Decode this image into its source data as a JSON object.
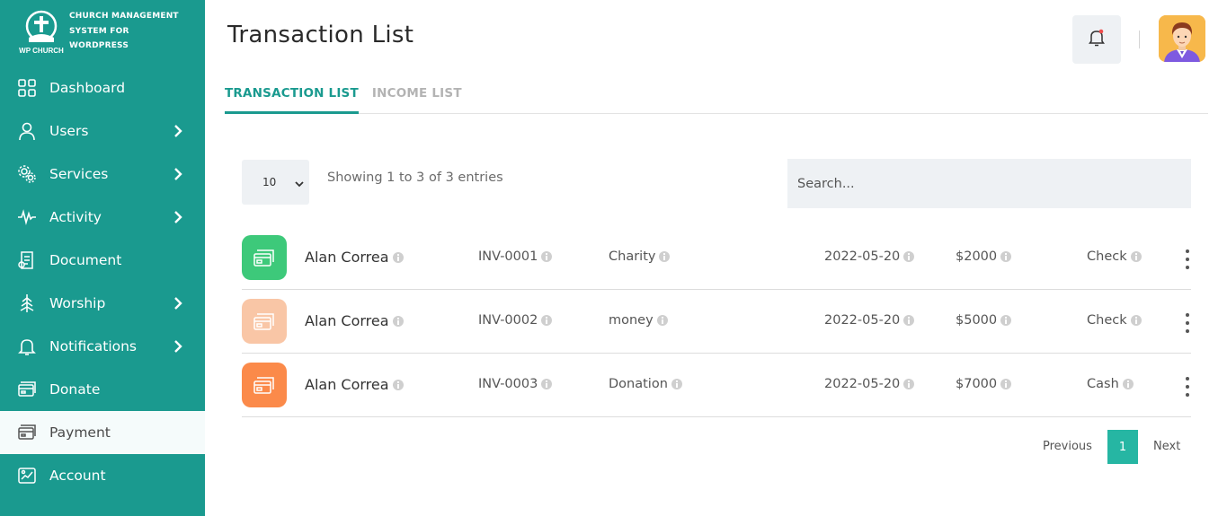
{
  "brand": {
    "logo_caption": "WP CHURCH",
    "title_lines": [
      "CHURCH MANAGEMENT",
      "SYSTEM FOR",
      "WORDPRESS"
    ]
  },
  "sidebar": {
    "items": [
      {
        "label": "Dashboard",
        "icon": "grid-icon",
        "has_chevron": false
      },
      {
        "label": "Users",
        "icon": "user-icon",
        "has_chevron": true
      },
      {
        "label": "Services",
        "icon": "gears-icon",
        "has_chevron": true
      },
      {
        "label": "Activity",
        "icon": "pulse-icon",
        "has_chevron": true
      },
      {
        "label": "Document",
        "icon": "document-icon",
        "has_chevron": false
      },
      {
        "label": "Worship",
        "icon": "tree-icon",
        "has_chevron": true
      },
      {
        "label": "Notifications",
        "icon": "bell-icon",
        "has_chevron": true
      },
      {
        "label": "Donate",
        "icon": "donate-card-icon",
        "has_chevron": false
      },
      {
        "label": "Payment",
        "icon": "payment-card-icon",
        "has_chevron": false,
        "active": true
      },
      {
        "label": "Account",
        "icon": "account-chart-icon",
        "has_chevron": false
      }
    ]
  },
  "header": {
    "title": "Transaction List"
  },
  "tabs": [
    {
      "label": "TRANSACTION LIST",
      "active": true
    },
    {
      "label": "INCOME LIST",
      "active": false
    }
  ],
  "table_controls": {
    "page_length": "10",
    "entries_info": "Showing 1 to 3 of 3 entries",
    "search_placeholder": "Search..."
  },
  "transactions": [
    {
      "name": "Alan Correa",
      "invoice": "INV-0001",
      "type": "Charity",
      "date": "2022-05-20",
      "amount": "$2000",
      "method": "Check",
      "icon_color": "#3dc97a"
    },
    {
      "name": "Alan Correa",
      "invoice": "INV-0002",
      "type": "money",
      "date": "2022-05-20",
      "amount": "$5000",
      "method": "Check",
      "icon_color": "#f9c6a6"
    },
    {
      "name": "Alan Correa",
      "invoice": "INV-0003",
      "type": "Donation",
      "date": "2022-05-20",
      "amount": "$7000",
      "method": "Cash",
      "icon_color": "#fb8a4a"
    }
  ],
  "pagination": {
    "previous": "Previous",
    "current": "1",
    "next": "Next"
  },
  "colors": {
    "brand": "#1a9a8f",
    "accent": "#26b6a3",
    "panel": "#eef1f4"
  }
}
